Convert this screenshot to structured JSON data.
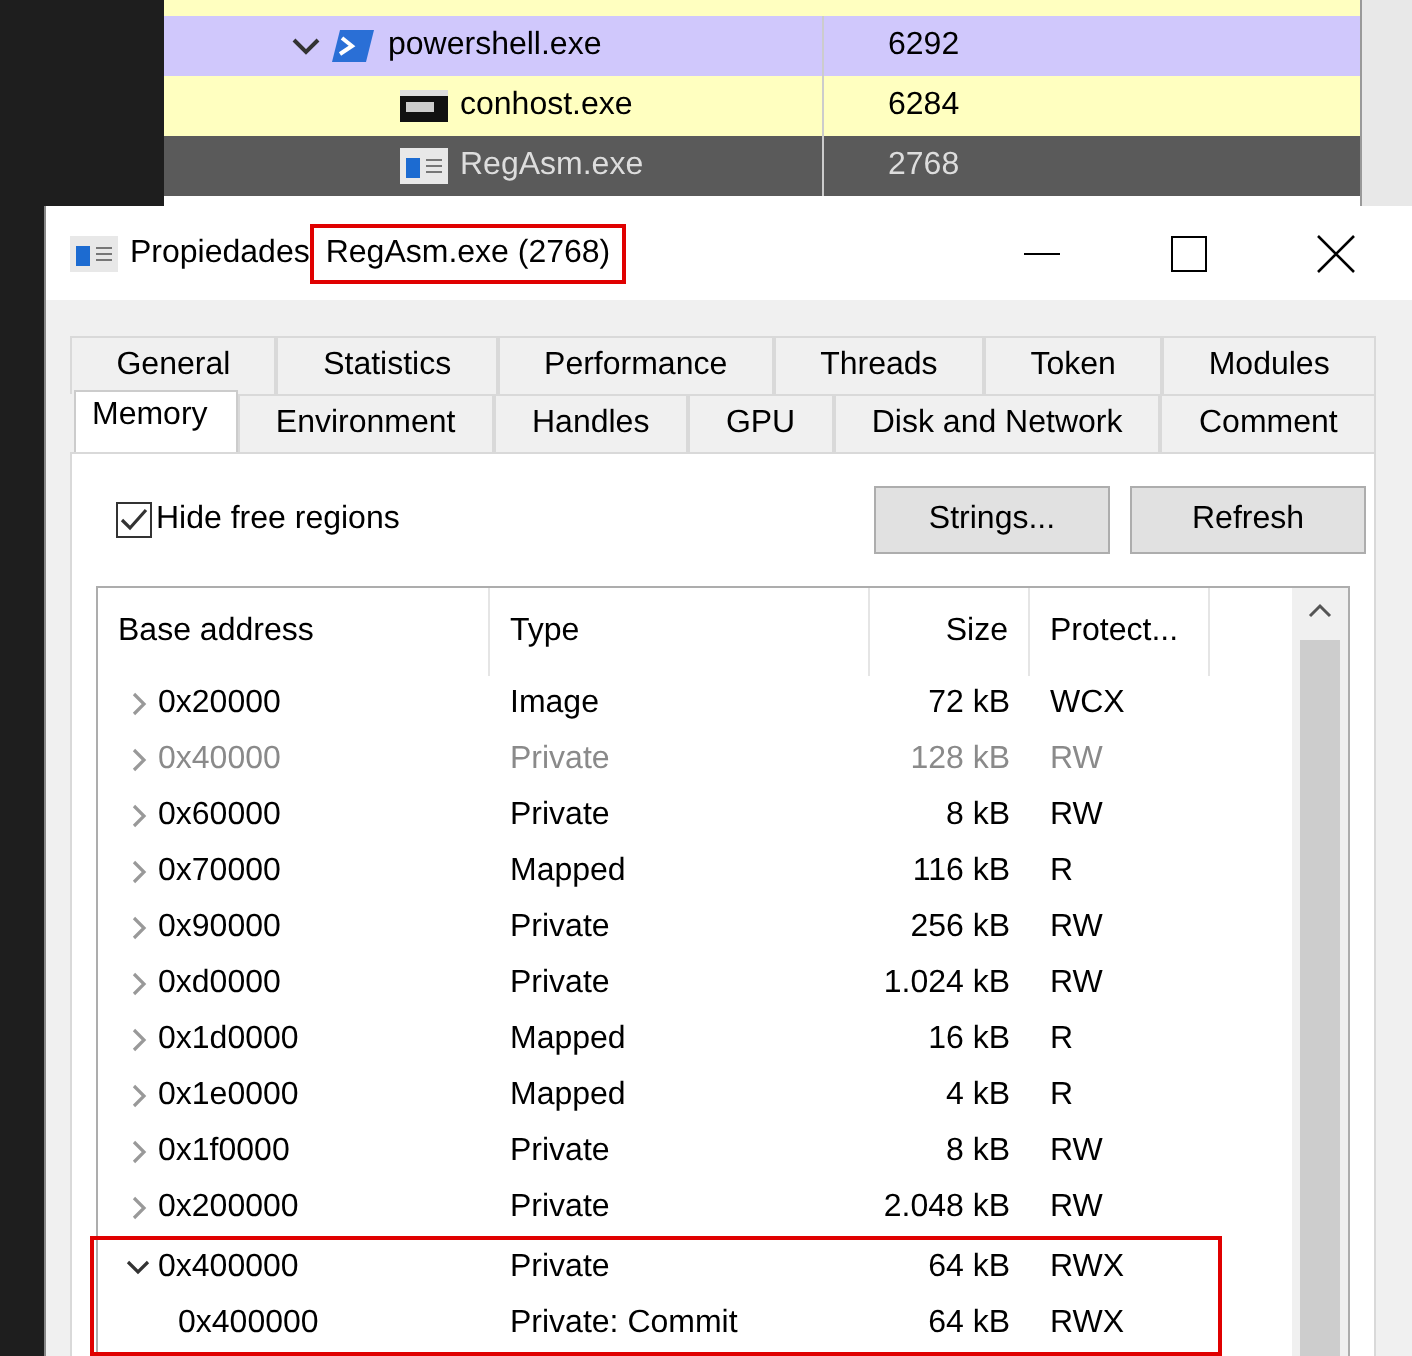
{
  "process_list": {
    "cut_row": {
      "color": "#ffffc0"
    },
    "rows": [
      {
        "name": "powershell.exe",
        "pid": "6292",
        "color": "#d0c8fc",
        "kind": "powershell",
        "expanded": true,
        "selected": false,
        "children": [
          {
            "name": "conhost.exe",
            "pid": "6284",
            "color": "#ffffc0",
            "kind": "console",
            "selected": false
          },
          {
            "name": "RegAsm.exe",
            "pid": "2768",
            "color": "#5a5a5a",
            "kind": "app",
            "selected": true
          }
        ]
      }
    ]
  },
  "window": {
    "title": "Propiedades",
    "title_process": "RegAsm.exe (2768)",
    "title_process_highlighted": true
  },
  "tab_rows": [
    [
      {
        "label": "General",
        "selected": false
      },
      {
        "label": "Statistics",
        "selected": false
      },
      {
        "label": "Performance",
        "selected": false
      },
      {
        "label": "Threads",
        "selected": false
      },
      {
        "label": "Token",
        "selected": false
      },
      {
        "label": "Modules",
        "selected": false
      }
    ],
    [
      {
        "label": "Memory",
        "selected": true
      },
      {
        "label": "Environment",
        "selected": false
      },
      {
        "label": "Handles",
        "selected": false
      },
      {
        "label": "GPU",
        "selected": false
      },
      {
        "label": "Disk and Network",
        "selected": false
      },
      {
        "label": "Comment",
        "selected": false
      }
    ]
  ],
  "hide_free_regions": {
    "label": "Hide free regions",
    "checked": true
  },
  "buttons": [
    "Strings...",
    "Refresh"
  ],
  "table": {
    "columns": [
      "Base address",
      "Type",
      "Size",
      "Protect..."
    ],
    "rows": [
      {
        "address": "0x20000",
        "type": "Image",
        "size": "72 kB",
        "protect": "WCX",
        "greyed": false,
        "expanded": false,
        "highlighted": false
      },
      {
        "address": "0x40000",
        "type": "Private",
        "size": "128 kB",
        "protect": "RW",
        "greyed": true,
        "expanded": false,
        "highlighted": false
      },
      {
        "address": "0x60000",
        "type": "Private",
        "size": "8 kB",
        "protect": "RW",
        "greyed": false,
        "expanded": false,
        "highlighted": false
      },
      {
        "address": "0x70000",
        "type": "Mapped",
        "size": "116 kB",
        "protect": "R",
        "greyed": false,
        "expanded": false,
        "highlighted": false
      },
      {
        "address": "0x90000",
        "type": "Private",
        "size": "256 kB",
        "protect": "RW",
        "greyed": false,
        "expanded": false,
        "highlighted": false
      },
      {
        "address": "0xd0000",
        "type": "Private",
        "size": "1.024 kB",
        "protect": "RW",
        "greyed": false,
        "expanded": false,
        "highlighted": false
      },
      {
        "address": "0x1d0000",
        "type": "Mapped",
        "size": "16 kB",
        "protect": "R",
        "greyed": false,
        "expanded": false,
        "highlighted": false
      },
      {
        "address": "0x1e0000",
        "type": "Mapped",
        "size": "4 kB",
        "protect": "R",
        "greyed": false,
        "expanded": false,
        "highlighted": false
      },
      {
        "address": "0x1f0000",
        "type": "Private",
        "size": "8 kB",
        "protect": "RW",
        "greyed": false,
        "expanded": false,
        "highlighted": false
      },
      {
        "address": "0x200000",
        "type": "Private",
        "size": "2.048 kB",
        "protect": "RW",
        "greyed": false,
        "expanded": false,
        "highlighted": false
      },
      {
        "address": "0x400000",
        "type": "Private",
        "size": "64 kB",
        "protect": "RWX",
        "greyed": false,
        "expanded": true,
        "highlighted": true,
        "children": [
          {
            "address": "0x400000",
            "type": "Private: Commit",
            "size": "64 kB",
            "protect": "RWX",
            "greyed": false
          }
        ]
      }
    ]
  }
}
